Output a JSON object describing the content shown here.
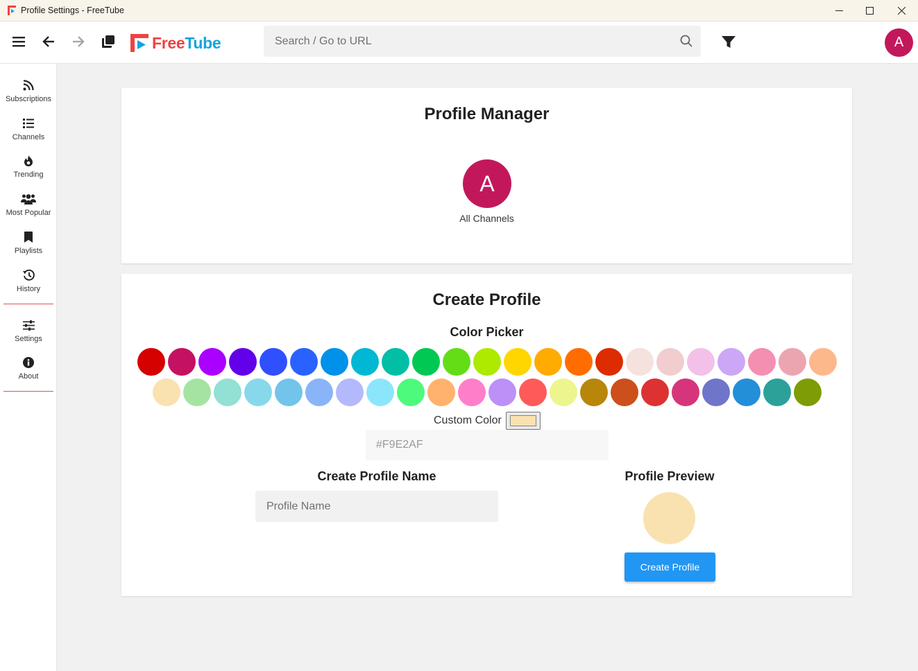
{
  "window": {
    "title": "Profile Settings - FreeTube"
  },
  "topnav": {
    "logo_free": "Free",
    "logo_tube": "Tube",
    "search_placeholder": "Search / Go to URL",
    "avatar_letter": "A"
  },
  "sidebar": {
    "items": [
      {
        "label": "Subscriptions",
        "icon": "rss-icon"
      },
      {
        "label": "Channels",
        "icon": "list-icon"
      },
      {
        "label": "Trending",
        "icon": "fire-icon"
      },
      {
        "label": "Most Popular",
        "icon": "users-icon"
      },
      {
        "label": "Playlists",
        "icon": "bookmark-icon"
      },
      {
        "label": "History",
        "icon": "history-icon"
      },
      {
        "label": "Settings",
        "icon": "sliders-icon"
      },
      {
        "label": "About",
        "icon": "info-icon"
      }
    ]
  },
  "profile_manager": {
    "title": "Profile Manager",
    "profiles": [
      {
        "letter": "A",
        "name": "All Channels",
        "color": "#c2185b"
      }
    ]
  },
  "create_profile": {
    "title": "Create Profile",
    "color_picker_label": "Color Picker",
    "colors_row1": [
      "#d50000",
      "#c51162",
      "#aa00ff",
      "#6200ea",
      "#304ffe",
      "#2962ff",
      "#0091ea",
      "#00b8d4",
      "#00bfa5",
      "#00c853",
      "#64dd17",
      "#aeea00",
      "#ffd600",
      "#ffab00",
      "#ff6d00",
      "#dd2c00",
      "#f5e1dd",
      "#f1cdcf",
      "#f3c1e7",
      "#cca7f6",
      "#f48fb1",
      "#eba5b1",
      "#fcb88b"
    ],
    "colors_row2": [
      "#f9e2af",
      "#a5e3a3",
      "#93e0d5",
      "#88d8ec",
      "#73c4ea",
      "#8ab4f8",
      "#b3b9fb",
      "#8ce6fb",
      "#4dfa7c",
      "#ffb26d",
      "#ff7ec9",
      "#bc90f7",
      "#ff5a5a",
      "#ecf58e",
      "#b8860b",
      "#cd4f1b",
      "#dc3232",
      "#d6357c",
      "#6f75c9",
      "#238fd9",
      "#2ba199",
      "#7e9c06"
    ],
    "custom_color_label": "Custom Color",
    "custom_color_value": "#F9E2AF",
    "hex_input_value": "#F9E2AF",
    "name_label": "Create Profile Name",
    "name_placeholder": "Profile Name",
    "preview_label": "Profile Preview",
    "preview_color": "#f9e2af",
    "create_button_label": "Create Profile"
  }
}
